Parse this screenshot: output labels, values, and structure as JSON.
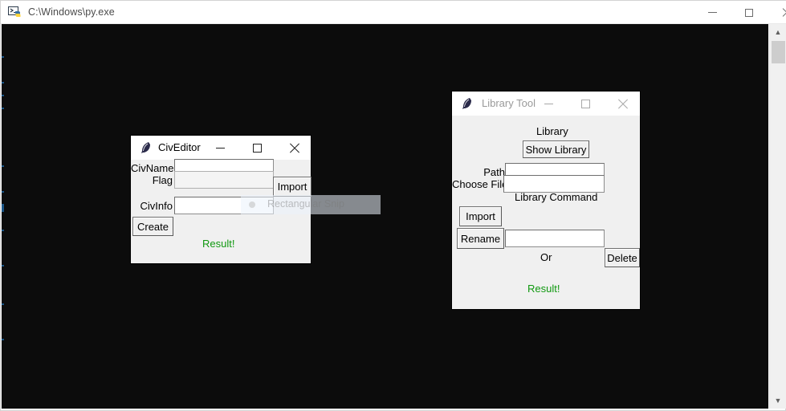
{
  "console": {
    "title": "C:\\Windows\\py.exe",
    "icon": "python-console-icon",
    "controls": {
      "minimize": "Minimize",
      "maximize": "Maximize",
      "close": "Close"
    },
    "scrollbar": {
      "up_arrow": "▲",
      "down_arrow": "▼"
    }
  },
  "snip_overlay": {
    "label": "Rectangular Snip",
    "icon": "snip-dot-icon"
  },
  "civeditor": {
    "title": "CivEditor",
    "icon": "tk-feather-icon",
    "controls": {
      "minimize": "Minimize",
      "maximize": "Maximize",
      "close": "Close"
    },
    "fields": [
      {
        "label": "CivName",
        "value": "",
        "placeholder": ""
      },
      {
        "label": "Flag",
        "value": "",
        "placeholder": ""
      },
      {
        "label": "CivInfo",
        "value": "",
        "placeholder": ""
      }
    ],
    "buttons": {
      "import": "Import",
      "create": "Create"
    },
    "status": "Result!",
    "status_color": "#119911"
  },
  "library_tool": {
    "title": "Library Tool",
    "icon": "tk-feather-icon",
    "controls": {
      "minimize": "Minimize",
      "maximize": "Maximize",
      "close": "Close"
    },
    "section_library": "Library",
    "show_library_button": "Show Library",
    "fields": [
      {
        "label": "Path",
        "value": "",
        "placeholder": ""
      },
      {
        "label": "Choose File",
        "value": "",
        "placeholder": ""
      }
    ],
    "section_command": "Library Command",
    "buttons": {
      "import": "Import",
      "rename": "Rename",
      "delete": "Delete"
    },
    "command_value": "",
    "or_label": "Or",
    "status": "Result!",
    "status_color": "#119911"
  }
}
